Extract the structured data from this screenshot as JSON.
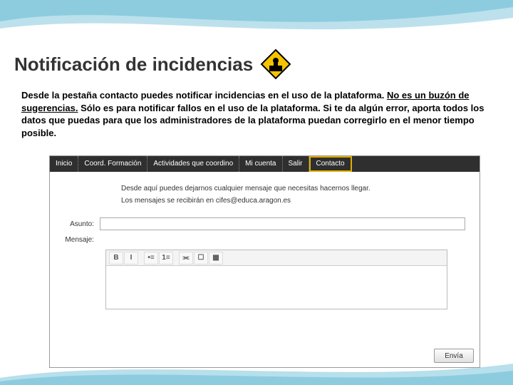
{
  "title": "Notificación de incidencias",
  "body": {
    "p1_a": "Desde la pestaña contacto puedes notificar incidencias en el uso de la plataforma. ",
    "p1_b": "No es un buzón de sugerencias.",
    "p1_c": " Sólo es para notificar fallos en el uso de la plataforma. Si te da algún error, aporta todos los datos que puedas para que los administradores de la plataforma puedan corregirlo en el menor tiempo posible."
  },
  "nav": {
    "inicio": "Inicio",
    "coord": "Coord. Formación",
    "actividades": "Actividades que coordino",
    "cuenta": "Mi cuenta",
    "salir": "Salir",
    "contacto": "Contacto"
  },
  "intro": {
    "line1": "Desde aquí puedes dejarnos cualquier mensaje que necesitas hacernos llegar.",
    "line2": "Los mensajes se recibirán en cifes@educa.aragon.es"
  },
  "form": {
    "asunto_label": "Asunto:",
    "mensaje_label": "Mensaje:",
    "send": "Envía"
  },
  "toolbar_icons": {
    "bold": "B",
    "italic": "I",
    "ul": "•≡",
    "ol": "1≡",
    "link": "⫘",
    "img": "☐",
    "tbl": "▦"
  }
}
